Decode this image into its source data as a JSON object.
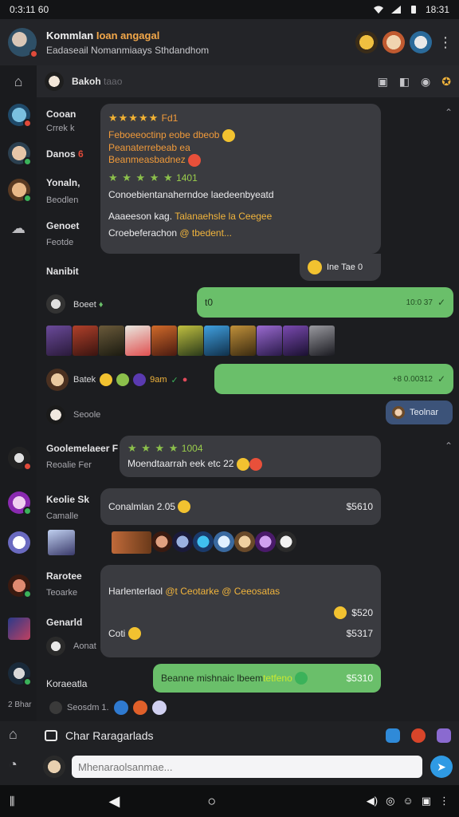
{
  "status": {
    "time": "0:3:11 60",
    "right_time": "18:31"
  },
  "header": {
    "title_a": "Kommlan ",
    "title_highlight": "Ioan angagal",
    "subtitle": "Eadaseail   Nomanmiaays Sthdandhom"
  },
  "sidebar": {
    "section_label": "Char"
  },
  "subheader": {
    "name": "Bakoh",
    "muted": "taao"
  },
  "messages": {
    "g1_name": "Cooan",
    "g1_sub": "Crrek k",
    "g2_name": "Danos",
    "g2_badge": "6",
    "g3_name": "Yonaln,",
    "g3_sub": "Beodlen",
    "g4_name": "Genoet",
    "g4_sub": "Feotde",
    "g5_name": "Nanibit",
    "card1": {
      "rating": "★★★★★",
      "rating_label": "Fd1",
      "line1": "Feboeeoctinp eobe dbeob",
      "line2": "Peanaterrebeab ea",
      "line3": "Beanmeasbadnez",
      "rating2": "★ ★ ★ ★ ★",
      "rating2_label": "1401",
      "line4": "Conoebientanaherndoe laedeenbyeatd",
      "line5_a": "Aaaeeson kag. ",
      "line5_b": "Talanaehsle la Ceegee",
      "line6_a": "Croebeferachon ",
      "line6_b": "@ tbedent...",
      "footer": "Ine Tae 0"
    },
    "row_boent": "Boeet",
    "bubble1_text": "t0",
    "bubble1_time": "10:0 37",
    "row_batek": "Batek",
    "row_batek_tag": "9am",
    "bubble2_time": "+8 0.00312",
    "row_seoole": "Seoole",
    "bubble3_text": "Teolnar",
    "g6_name": "Goolemelaeer F",
    "g6_sub": "Reoalie  Fer",
    "card2_rating": "★ ★ ★ ★",
    "card2_label": "1004",
    "card2_text": "Moendtaarrah eek etc 22",
    "g7_name": "Keolie Sk",
    "g7_sub": "Camalle",
    "card3_text": "Conalmlan 2.05",
    "card3_price": "$5610",
    "g8_name": "Rarotee",
    "g8_sub": "Teoarke",
    "g9_name": "Genarld",
    "g9_sub": "Aonat",
    "card4_line1_a": "Harlenterlaol ",
    "card4_line1_b": "@t Ceotarke @ Ceeosatas",
    "card4_price1": "$520",
    "card4_line2": "Coti",
    "card4_price2": "$5317",
    "g10_name": "Koraeatla",
    "bubble4_a": "Beanne mishnaic lbeem ",
    "bubble4_b": "tetfeno",
    "bubble4_price": "$5310",
    "g11_sub": "Seosdm 1.",
    "sidebar_tag": "2 Bhar"
  },
  "composer": {
    "title": "Char Raragarlads",
    "placeholder": "Mhenaraolsanmae..."
  },
  "colors": {
    "accent_green": "#6abf6a",
    "accent_blue": "#2f9ae4",
    "card_bg": "#3a3b40",
    "star": "#f2b233"
  }
}
